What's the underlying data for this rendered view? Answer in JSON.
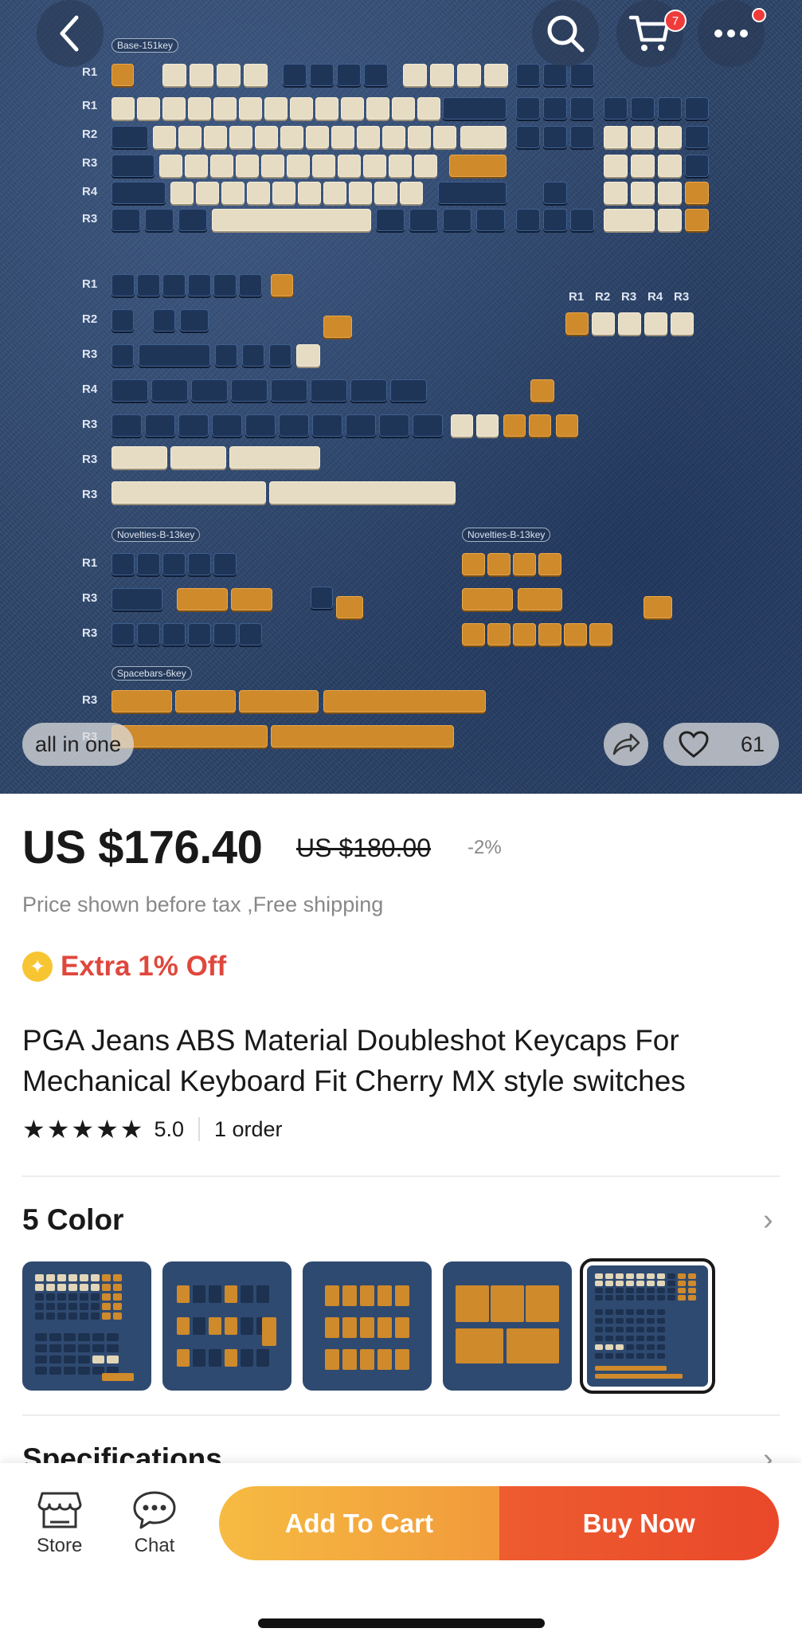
{
  "hero": {
    "image_label": "all in one",
    "cart_count": "7",
    "like_count": "61",
    "section_tags": [
      "Base-151key",
      "Novelties-B-13key",
      "Novelties-B-13key",
      "Spacebars-6key"
    ],
    "icons": {
      "back": "chevron-left-icon",
      "search": "search-icon",
      "cart": "cart-icon",
      "more": "more-icon",
      "share": "share-icon",
      "like": "heart-icon"
    }
  },
  "product": {
    "price": "US $176.40",
    "original_price": "US $180.00",
    "discount": "-2%",
    "tax_note": "Price shown before tax ,Free shipping",
    "promo": "Extra 1% Off",
    "title": "PGA Jeans ABS Material Doubleshot Keycaps For Mechanical Keyboard Fit Cherry MX style switches",
    "rating": "5.0",
    "stars": "★★★★★",
    "orders": "1 order"
  },
  "variants": {
    "title": "5 Color",
    "selected_index": 4,
    "count": 5
  },
  "specifications": {
    "title": "Specifications"
  },
  "bottom_bar": {
    "store_label": "Store",
    "chat_label": "Chat",
    "add_to_cart": "Add To Cart",
    "buy_now": "Buy Now"
  },
  "colors": {
    "price_red": "#e0473c",
    "cart_gradient": "#f6bb42",
    "buy_gradient": "#e9482a",
    "denim": "#2c4468"
  }
}
